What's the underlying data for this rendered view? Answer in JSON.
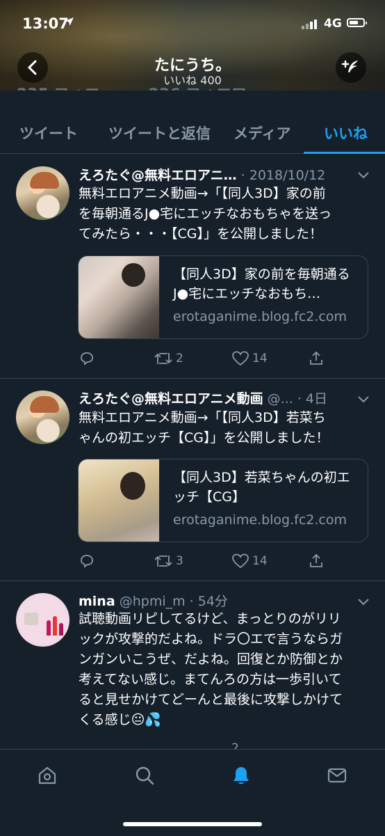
{
  "status_bar": {
    "time": "13:07",
    "network": "4G"
  },
  "header": {
    "title": "たにうち。",
    "subtitle": "いいね 400"
  },
  "profile_counts_peek": {
    "following": "235 フォロー",
    "followers": "236 フォロワー"
  },
  "tabs": [
    {
      "label": "ツイート",
      "active": false
    },
    {
      "label": "ツイートと返信",
      "active": false
    },
    {
      "label": "メディア",
      "active": false
    },
    {
      "label": "いいね",
      "active": true
    }
  ],
  "tweets": [
    {
      "name": "えろたぐ@無料エロアニ…",
      "meta": "· 2018/10/12",
      "text": "無料エロアニメ動画→「【同人3D】家の前\nを毎朝通るJ●宅にエッチなおもちゃを送っ\nてみたら・・・【CG】」を公開しました！",
      "card_title": "【同人3D】家の前を毎朝通るJ●宅にエッチなおもち…",
      "card_url": "erotaganime.blog.fc2.com",
      "retweets": "2",
      "likes": "14"
    },
    {
      "name": "えろたぐ@無料エロアニメ動画",
      "meta": "@... · 4日",
      "text": "無料エロアニメ動画→「【同人3D】若菜ち\nゃんの初エッチ【CG】」を公開しました！",
      "card_title": "【同人3D】若菜ちゃんの初エッチ【CG】",
      "card_url": "erotaganime.blog.fc2.com",
      "retweets": "3",
      "likes": "14"
    },
    {
      "name": "mina",
      "meta": "@hpmi_m · 54分",
      "text": "試聴動画リピしてるけど、まっとりのがリリ\nックが攻撃的だよね。ドラ〇エで言うならガ\nンガンいこうぜ、だよね。回復とか防御とか\n考えてない感じ。まてんろの方は一歩引いて\nると見せかけてどーんと最後に攻撃しかけて\nくる感じ😐💦",
      "retweets": "",
      "likes": "2"
    }
  ],
  "colors": {
    "background": "#15202b",
    "accent": "#1da1f2",
    "muted": "#8899a6",
    "divider": "#38444d"
  },
  "bottom_tabs": [
    "home-icon",
    "search-icon",
    "notifications-icon",
    "messages-icon"
  ]
}
